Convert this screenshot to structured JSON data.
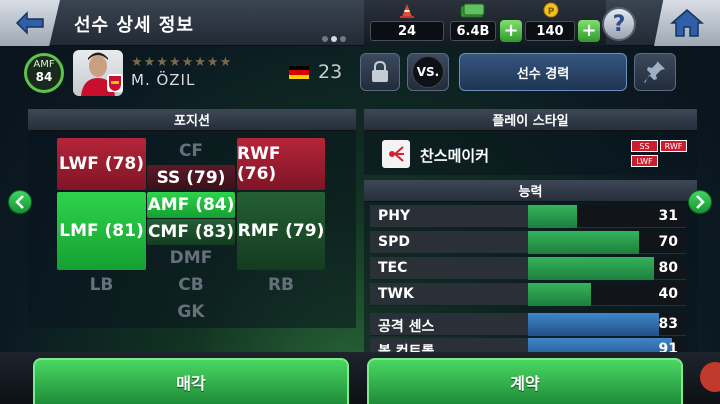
{
  "header": {
    "title": "선수 상세 정보",
    "currency": [
      {
        "icon": "cone-icon",
        "value": "24"
      },
      {
        "icon": "cash-icon",
        "value": "6.4B"
      },
      {
        "icon": "coin-icon",
        "value": "140"
      }
    ],
    "help_label": "?"
  },
  "player": {
    "position": "AMF",
    "rating": "84",
    "stars": "★★★★★★★★",
    "name": "M. ÖZIL",
    "age": "23",
    "flag_colors": [
      "#000000",
      "#dd0000",
      "#ffce00"
    ]
  },
  "buttons": {
    "vs": "VS.",
    "career": "선수 경력",
    "sell": "매각",
    "contract": "계약"
  },
  "position_panel": {
    "title": "포지션",
    "cells": {
      "lwf": "LWF (78)",
      "cf": "CF",
      "rwf": "RWF (76)",
      "ss": "SS (79)",
      "amf": "AMF (84)",
      "lmf": "LMF (81)",
      "cmf": "CMF (83)",
      "rmf": "RMF (79)",
      "dmf": "DMF",
      "lb": "LB",
      "cb": "CB",
      "rb": "RB",
      "gk": "GK"
    }
  },
  "playstyle_panel": {
    "title": "플레이 스타일",
    "style_name": "찬스메이커",
    "tags": [
      "SS",
      "RWF",
      "LWF"
    ]
  },
  "ability_panel": {
    "title": "능력",
    "stats": [
      {
        "label": "PHY",
        "value": "31",
        "fill": 0.31
      },
      {
        "label": "SPD",
        "value": "70",
        "fill": 0.7
      },
      {
        "label": "TEC",
        "value": "80",
        "fill": 0.8
      },
      {
        "label": "TWK",
        "value": "40",
        "fill": 0.4
      },
      {
        "label": "공격 센스",
        "value": "83",
        "fill": 0.83
      },
      {
        "label": "볼 컨트롤",
        "value": "91",
        "fill": 0.91
      }
    ]
  },
  "colors": {
    "accent_green": "#2fd34c",
    "accent_red": "#b6253a",
    "accent_blue": "#3f86c9"
  }
}
